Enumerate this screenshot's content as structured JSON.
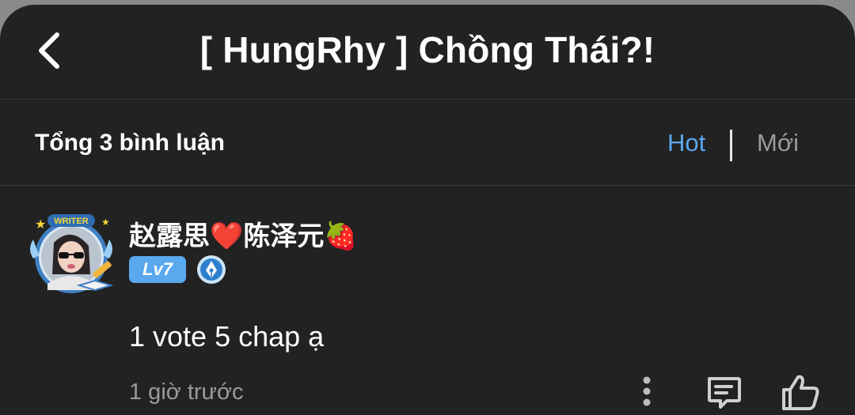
{
  "header": {
    "title": "[ HungRhy ] Chồng Thái?!",
    "back_icon": "chevron-left-icon"
  },
  "comments_bar": {
    "total_label": "Tổng 3 bình luận",
    "sort_options": [
      {
        "label": "Hot",
        "active": true,
        "color": "#5aa8ee"
      },
      {
        "label": "Mới",
        "active": false,
        "color": "#9a9a9a"
      }
    ]
  },
  "comment": {
    "author": "赵露思❤️陈泽元🍓",
    "avatar_frame_text": "WRITER",
    "level": "Lv7",
    "badge_icon": "pen-nib-icon",
    "text": "1 vote 5 chap ạ",
    "time": "1 giờ trước",
    "actions": [
      "more-vertical-icon",
      "reply-comment-icon",
      "thumbs-up-icon"
    ]
  },
  "colors": {
    "background": "#222222",
    "accent": "#5aa8ee",
    "muted": "#9a9a9a"
  }
}
